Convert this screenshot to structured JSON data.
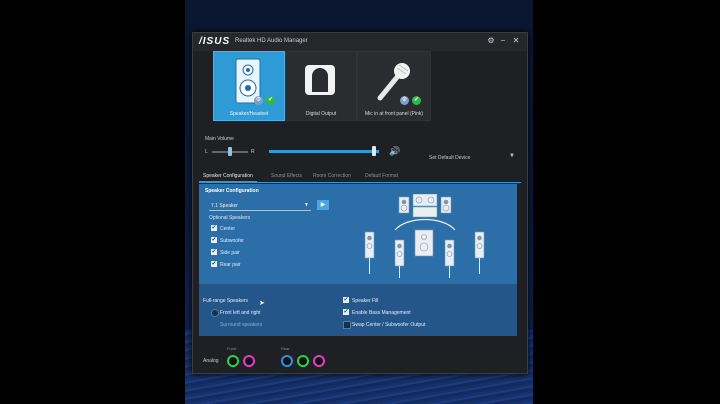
{
  "window": {
    "logo": "/ISUS",
    "title": "Realtek HD Audio Manager",
    "settings_glyph": "⚙",
    "minimize_glyph": "−",
    "close_glyph": "✕"
  },
  "devices": [
    {
      "name": "Speaker/Headset",
      "icon": "speaker-icon",
      "selected": true
    },
    {
      "name": "Digital Output",
      "icon": "digital-output-icon",
      "selected": false
    },
    {
      "name": "Mic in at front panel (Pink)",
      "icon": "microphone-icon",
      "selected": false
    }
  ],
  "volume": {
    "label": "Main Volume",
    "left": "L",
    "right": "R",
    "level_fraction": 0.95,
    "balance_fraction": 0.5,
    "set_default": "Set Default Device",
    "dropdown_glyph": "▼"
  },
  "tabs": [
    "Speaker Configuration",
    "Sound Effects",
    "Room Correction",
    "Default Format"
  ],
  "speaker_config": {
    "title": "Speaker Configuration",
    "selected_config": "7.1 Speaker",
    "dropdown_glyph": "▼",
    "play_glyph": "▶",
    "optional_title": "Optional Speakers",
    "check_glyph": "✔",
    "optional": [
      {
        "label": "Center",
        "checked": true
      },
      {
        "label": "Subwoofer",
        "checked": true
      },
      {
        "label": "Side pair",
        "checked": true
      },
      {
        "label": "Rear pair",
        "checked": true
      }
    ]
  },
  "full_range": {
    "title": "Full-range Speakers",
    "front": "Front left and right",
    "surround": "Surround speakers",
    "speaker_fill": "Speaker Fill",
    "bass_mgmt": "Enable Bass Management",
    "swap": "Swap Center / Subwoofer Output"
  },
  "jacks": {
    "front_label": "Front",
    "rear_label": "Rear",
    "analog_label": "Analog",
    "colors": {
      "green": "#2ad24a",
      "pink": "#e23cc8",
      "blue": "#2f8fe6"
    }
  },
  "colors": {
    "accent": "#2f9bd6",
    "panel": "#2b6ea8",
    "panel_dark": "#24568a"
  }
}
